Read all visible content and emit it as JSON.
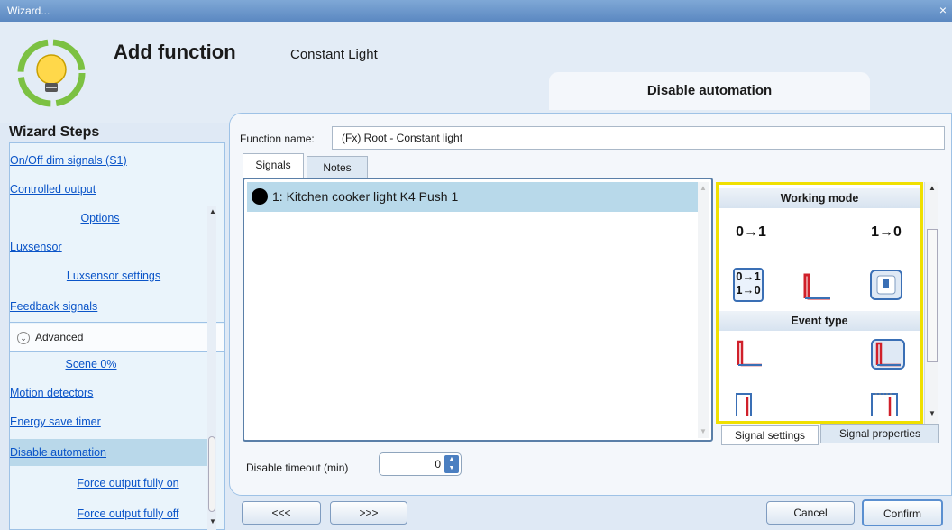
{
  "window": {
    "title": "Wizard...",
    "close_glyph": "×"
  },
  "header": {
    "title": "Add function",
    "subtitle": "Constant Light",
    "section_tab": "Disable automation",
    "logo": "bulb-recycle-logo"
  },
  "steps": {
    "title": "Wizard Steps",
    "items": [
      {
        "label": "On/Off dim signals (S1)"
      },
      {
        "label": "Controlled output"
      },
      {
        "label": "Options"
      },
      {
        "label": "Luxsensor"
      },
      {
        "label": "Luxsensor settings"
      },
      {
        "label": "Feedback signals"
      },
      {
        "label": "Advanced"
      },
      {
        "label": "Scene 0%"
      },
      {
        "label": "Motion detectors"
      },
      {
        "label": "Energy save timer"
      },
      {
        "label": "Disable automation"
      },
      {
        "label": "Force output fully on"
      },
      {
        "label": "Force output fully off"
      }
    ],
    "advanced_chevron": "⌄"
  },
  "function_name": {
    "label": "Function name:",
    "value": "(Fx) Root - Constant light"
  },
  "tabs": [
    {
      "label": "Signals"
    },
    {
      "label": "Notes"
    }
  ],
  "signals": [
    {
      "label": "1: Kitchen cooker light K4 Push 1"
    }
  ],
  "settings": {
    "working_mode_title": "Working mode",
    "mode_a": "0→1",
    "mode_b": "1→0",
    "mode_c_top": "0→1",
    "mode_c_bottom": "1→0",
    "event_type_title": "Event type"
  },
  "bottom_tabs": [
    {
      "label": "Signal settings"
    },
    {
      "label": "Signal properties"
    }
  ],
  "disable_timeout": {
    "label": "Disable timeout (min)",
    "value": "0"
  },
  "buttons": {
    "prev": "<<<",
    "next": ">>>",
    "cancel": "Cancel",
    "confirm": "Confirm"
  },
  "colors": {
    "accent": "#4b7fc1",
    "highlight": "#f0e000",
    "selected_row": "#b8d9ea",
    "signal_red": "#d0202a"
  }
}
